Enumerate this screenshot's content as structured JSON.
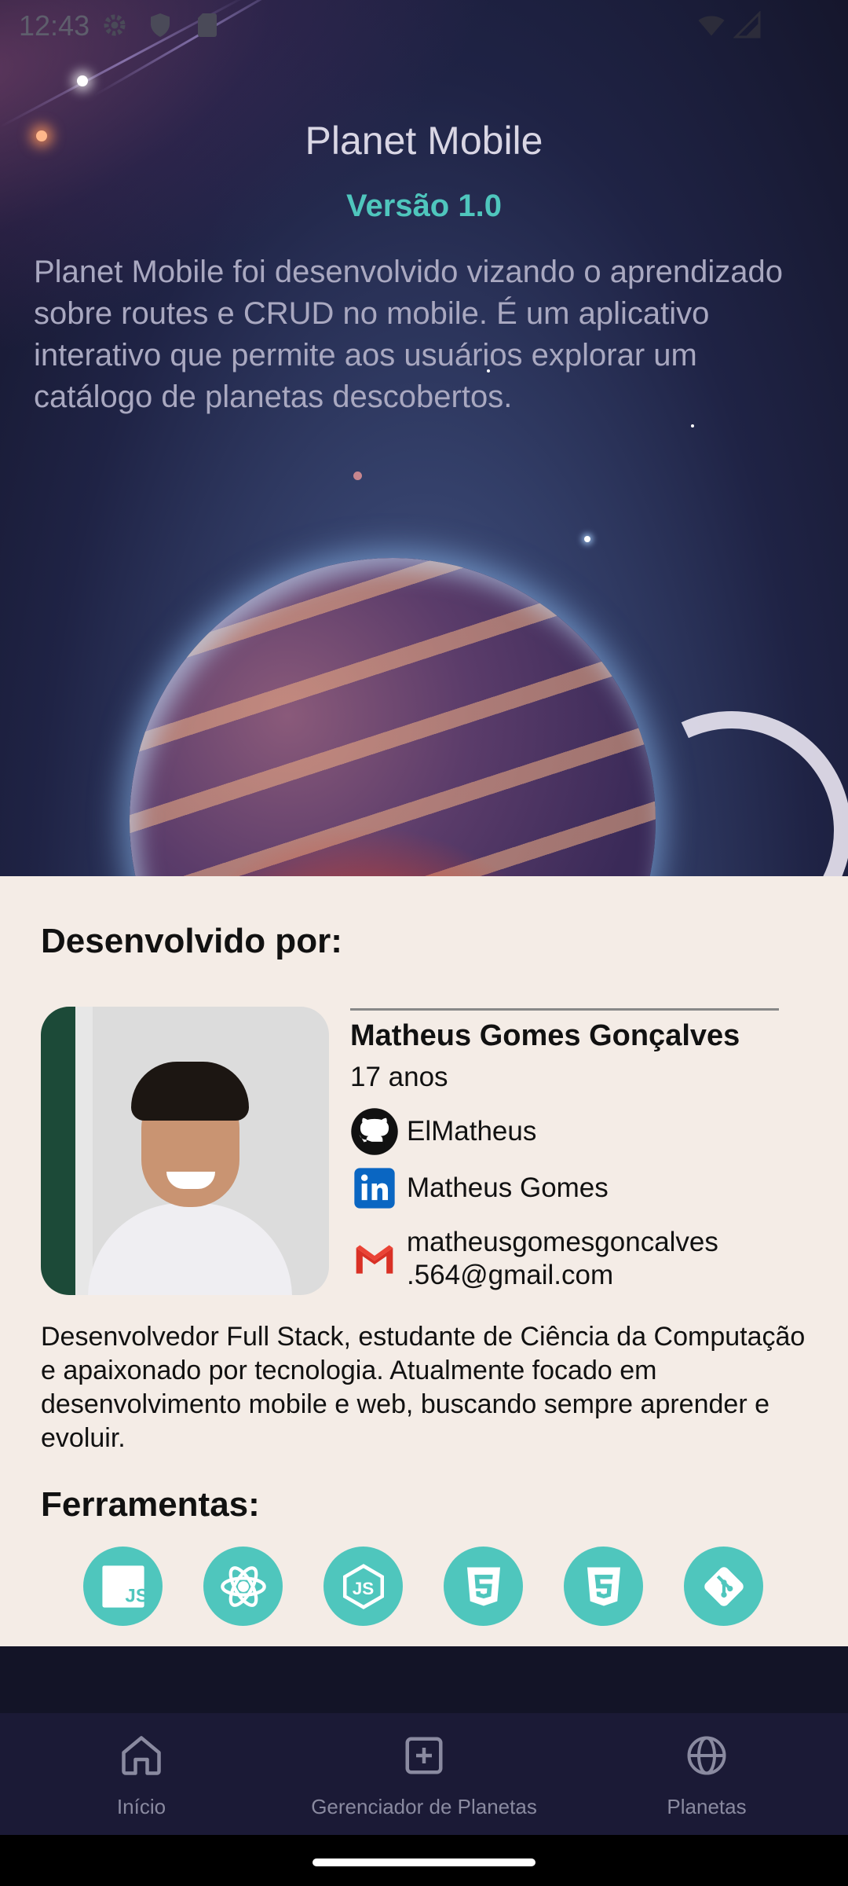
{
  "status_bar": {
    "time": "12:43"
  },
  "hero": {
    "title": "Planet Mobile",
    "version": "Versão 1.0",
    "description": "Planet Mobile foi desenvolvido vizando o aprendizado sobre routes e CRUD no mobile. É um aplicativo interativo que permite aos usuários explorar um catálogo de planetas descobertos."
  },
  "developer": {
    "section_title": "Desenvolvido por:",
    "name": "Matheus Gomes Gonçalves",
    "age": "17 anos",
    "github": "ElMatheus",
    "linkedin": "Matheus Gomes",
    "email_line1": "matheusgomesgoncalves",
    "email_line2": ".564@gmail.com",
    "bio": "Desenvolvedor Full Stack, estudante de Ciência da Computação e apaixonado por tecnologia. Atualmente focado em desenvolvimento mobile e web, buscando sempre aprender e evoluir."
  },
  "tools": {
    "section_title": "Ferramentas:",
    "items": [
      "javascript-icon",
      "react-icon",
      "nodejs-icon",
      "html5-icon",
      "css3-icon",
      "git-icon"
    ]
  },
  "bottom_nav": {
    "items": [
      {
        "label": "Início",
        "icon": "home-icon"
      },
      {
        "label": "Gerenciador de Planetas",
        "icon": "add-square-icon"
      },
      {
        "label": "Planetas",
        "icon": "globe-icon"
      }
    ]
  },
  "colors": {
    "accent": "#4fc6bd",
    "card_bg": "#f4ece6",
    "nav_bg": "#1b1a36"
  }
}
